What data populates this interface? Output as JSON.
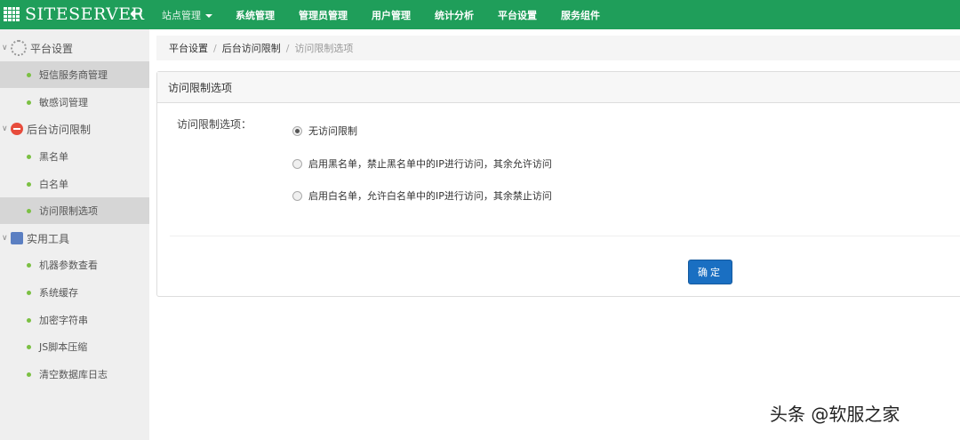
{
  "brand": {
    "logo_text": "SITESERVER"
  },
  "topnav": {
    "items": [
      {
        "label": "站点管理"
      },
      {
        "label": "系统管理"
      },
      {
        "label": "管理员管理"
      },
      {
        "label": "用户管理"
      },
      {
        "label": "统计分析"
      },
      {
        "label": "平台设置"
      },
      {
        "label": "服务组件"
      }
    ]
  },
  "sidebar": {
    "groups": [
      {
        "label": "平台设置",
        "icon": "gear-icon",
        "items": [
          {
            "label": "短信服务商管理",
            "active": true
          },
          {
            "label": "敏感词管理"
          }
        ]
      },
      {
        "label": "后台访问限制",
        "icon": "no-entry-icon",
        "items": [
          {
            "label": "黑名单"
          },
          {
            "label": "白名单"
          },
          {
            "label": "访问限制选项",
            "active": true
          }
        ]
      },
      {
        "label": "实用工具",
        "icon": "tools-icon",
        "items": [
          {
            "label": "机器参数查看"
          },
          {
            "label": "系统缓存"
          },
          {
            "label": "加密字符串"
          },
          {
            "label": "JS脚本压缩"
          },
          {
            "label": "清空数据库日志"
          }
        ]
      }
    ]
  },
  "breadcrumb": {
    "items": [
      "平台设置",
      "后台访问限制",
      "访问限制选项"
    ]
  },
  "panel": {
    "title": "访问限制选项",
    "field_label": "访问限制选项：",
    "options": [
      {
        "label": "无访问限制",
        "checked": true
      },
      {
        "label": "启用黑名单，禁止黑名单中的IP进行访问，其余允许访问",
        "checked": false
      },
      {
        "label": "启用白名单，允许白名单中的IP进行访问，其余禁止访问",
        "checked": false
      }
    ],
    "submit_label": "确定"
  },
  "watermark": "头条 @软服之家",
  "colors": {
    "topbar": "#1f9e5a",
    "button": "#1a6fc2",
    "sidebar_bg": "#efefef",
    "active_bg": "#d6d6d6",
    "dot": "#7bc043"
  }
}
